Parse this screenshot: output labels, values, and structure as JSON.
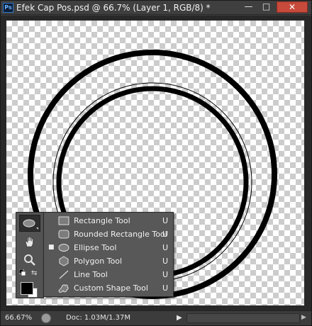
{
  "window": {
    "app_icon_label": "Ps",
    "title": "Efek Cap Pos.psd @ 66.7% (Layer 1, RGB/8) *",
    "minimize_glyph": "—",
    "maximize_glyph": "□",
    "close_glyph": "✕"
  },
  "canvas": {
    "content": "two concentric black rings on transparent (checkerboard) layer",
    "stroke_color": "#000000",
    "transparency_colors": [
      "#ffffff",
      "#cccccc"
    ]
  },
  "toolbox": {
    "active_tool_icon": "ellipse-tool-icon",
    "tools": [
      "hand-tool-icon",
      "zoom-tool-icon"
    ],
    "swap_glyph": "⇆",
    "foreground_color": "#000000",
    "background_color": "#ffffff"
  },
  "flyout": {
    "items": [
      {
        "label": "Rectangle Tool",
        "shortcut": "U",
        "icon": "rectangle-tool-icon",
        "selected": false,
        "bullet": ""
      },
      {
        "label": "Rounded Rectangle Tool",
        "shortcut": "U",
        "icon": "rounded-rectangle-tool-icon",
        "selected": false,
        "bullet": ""
      },
      {
        "label": "Ellipse Tool",
        "shortcut": "U",
        "icon": "ellipse-tool-icon",
        "selected": true,
        "bullet": "■"
      },
      {
        "label": "Polygon Tool",
        "shortcut": "U",
        "icon": "polygon-tool-icon",
        "selected": false,
        "bullet": ""
      },
      {
        "label": "Line Tool",
        "shortcut": "U",
        "icon": "line-tool-icon",
        "selected": false,
        "bullet": ""
      },
      {
        "label": "Custom Shape Tool",
        "shortcut": "U",
        "icon": "custom-shape-tool-icon",
        "selected": false,
        "bullet": ""
      }
    ]
  },
  "statusbar": {
    "zoom": "66.67%",
    "doc_info": "Doc: 1.03M/1.37M",
    "menu_arrow": "▶",
    "scroll_right_glyph": "▶"
  },
  "colors": {
    "chrome": "#3c3c3c",
    "panel": "#535353",
    "close_button": "#c74a3b"
  }
}
